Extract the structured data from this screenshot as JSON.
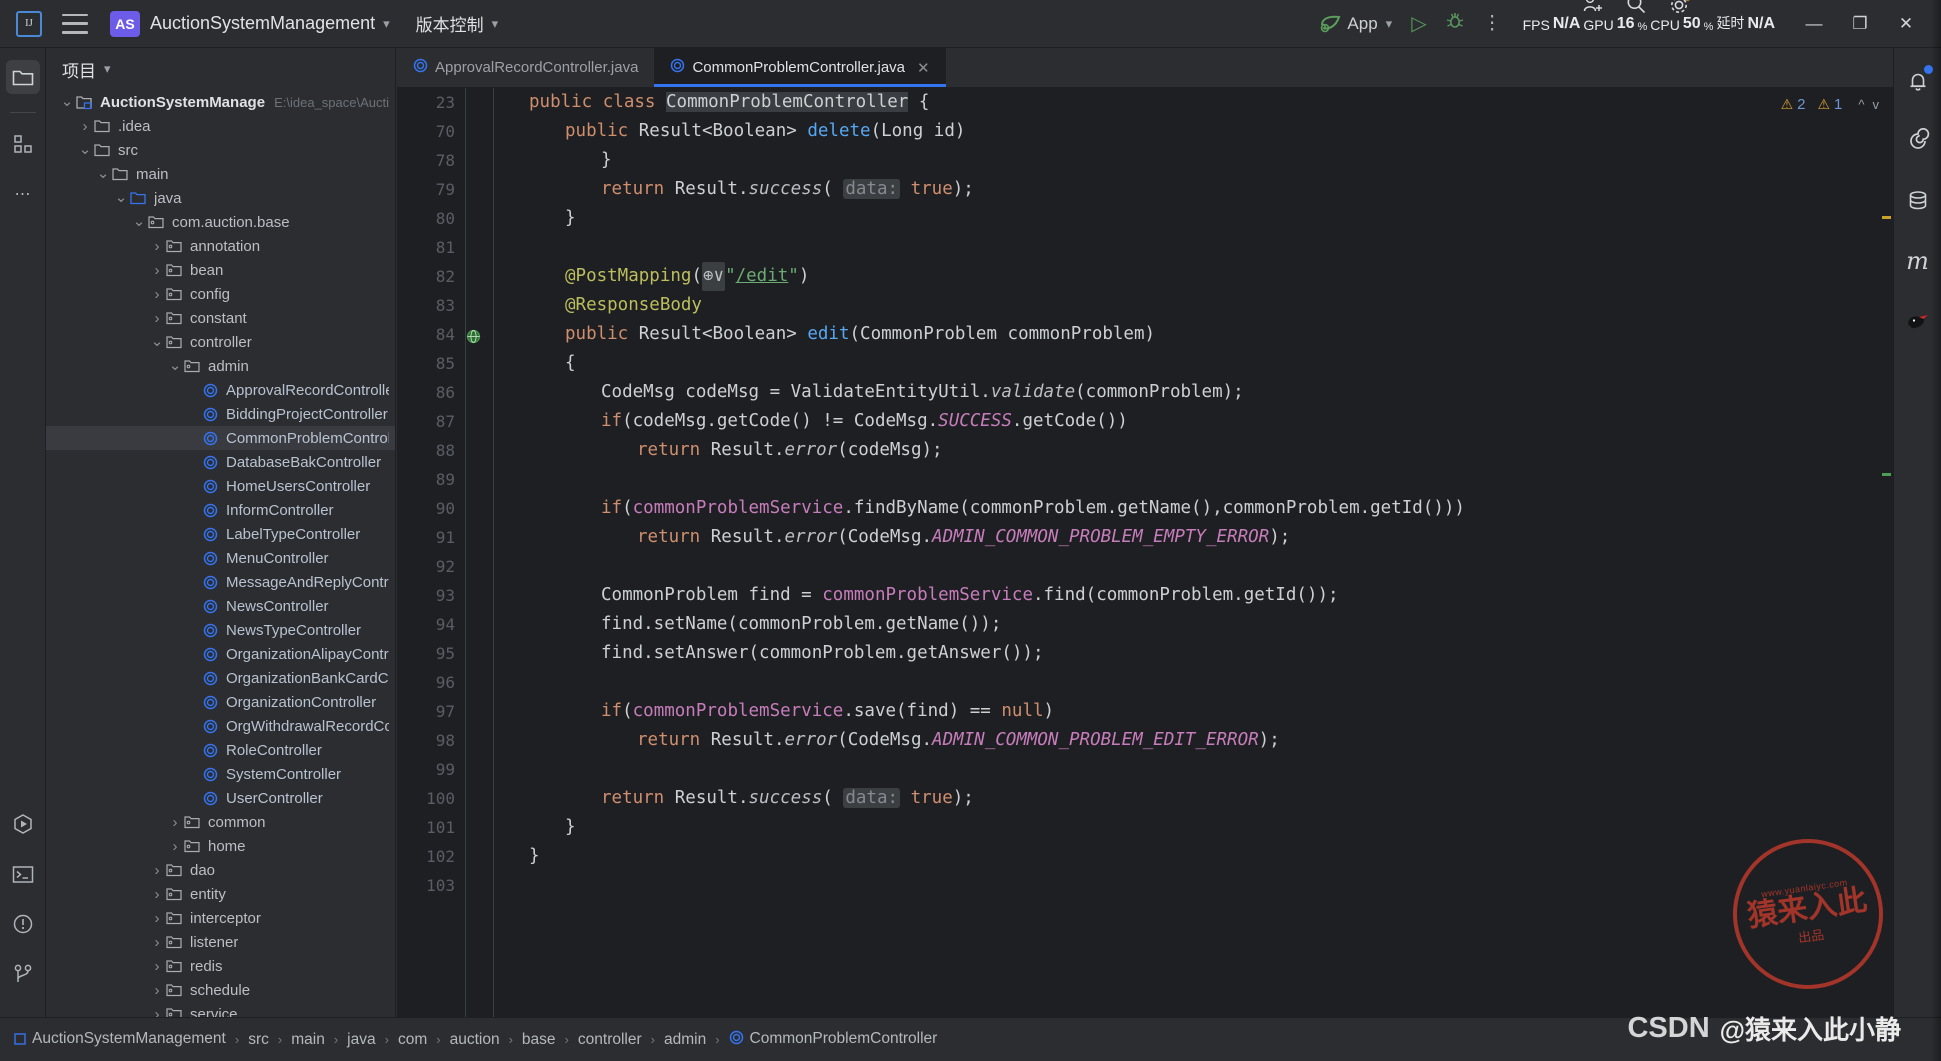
{
  "titlebar": {
    "logo": "ij-logo",
    "menu_icon": "hamburger-icon",
    "project_badge": "AS",
    "project_name": "AuctionSystemManagement",
    "vcs_label": "版本控制",
    "run_config": "App",
    "run_icon": "run-icon",
    "debug_icon": "debug-icon",
    "more_icon": "more-options-icon",
    "perf": {
      "fps_label": "FPS",
      "fps_value": "N/A",
      "gpu_label": "GPU",
      "gpu_value": "16",
      "gpu_unit": "%",
      "cpu_label": "CPU",
      "cpu_value": "50",
      "cpu_unit": "%",
      "lat_label": "延时",
      "lat_value": "N/A"
    },
    "window": {
      "minimize": "—",
      "maximize": "❐",
      "close": "✕"
    }
  },
  "left_strip": {
    "items": [
      {
        "name": "project-tool-icon",
        "glyph": "folder",
        "active": true
      },
      {
        "name": "structure-tool-icon",
        "glyph": "blocks",
        "active": false
      },
      {
        "name": "more-tool-windows-icon",
        "glyph": "dots",
        "active": false
      }
    ],
    "bottom": [
      {
        "name": "run-tool-icon",
        "glyph": "run-hex"
      },
      {
        "name": "terminal-tool-icon",
        "glyph": "terminal"
      },
      {
        "name": "problems-tool-icon",
        "glyph": "warning-circle"
      },
      {
        "name": "version-control-tool-icon",
        "glyph": "branch"
      }
    ]
  },
  "project_panel": {
    "title": "项目",
    "tree": [
      {
        "depth": 0,
        "arrow": "v",
        "icon": "module",
        "label": "AuctionSystemManagement",
        "bold": true,
        "path": "E:\\idea_space\\Aucti"
      },
      {
        "depth": 1,
        "arrow": ">",
        "icon": "folder",
        "label": ".idea"
      },
      {
        "depth": 1,
        "arrow": "v",
        "icon": "folder",
        "label": "src"
      },
      {
        "depth": 2,
        "arrow": "v",
        "icon": "folder",
        "label": "main"
      },
      {
        "depth": 3,
        "arrow": "v",
        "icon": "source-folder",
        "label": "java"
      },
      {
        "depth": 4,
        "arrow": "v",
        "icon": "package",
        "label": "com.auction.base"
      },
      {
        "depth": 5,
        "arrow": ">",
        "icon": "package",
        "label": "annotation"
      },
      {
        "depth": 5,
        "arrow": ">",
        "icon": "package",
        "label": "bean"
      },
      {
        "depth": 5,
        "arrow": ">",
        "icon": "package",
        "label": "config"
      },
      {
        "depth": 5,
        "arrow": ">",
        "icon": "package",
        "label": "constant"
      },
      {
        "depth": 5,
        "arrow": "v",
        "icon": "package",
        "label": "controller"
      },
      {
        "depth": 6,
        "arrow": "v",
        "icon": "package",
        "label": "admin"
      },
      {
        "depth": 7,
        "arrow": "",
        "icon": "class",
        "label": "ApprovalRecordController"
      },
      {
        "depth": 7,
        "arrow": "",
        "icon": "class",
        "label": "BiddingProjectController"
      },
      {
        "depth": 7,
        "arrow": "",
        "icon": "class",
        "label": "CommonProblemController",
        "selected": true
      },
      {
        "depth": 7,
        "arrow": "",
        "icon": "class",
        "label": "DatabaseBakController"
      },
      {
        "depth": 7,
        "arrow": "",
        "icon": "class",
        "label": "HomeUsersController"
      },
      {
        "depth": 7,
        "arrow": "",
        "icon": "class",
        "label": "InformController"
      },
      {
        "depth": 7,
        "arrow": "",
        "icon": "class",
        "label": "LabelTypeController"
      },
      {
        "depth": 7,
        "arrow": "",
        "icon": "class",
        "label": "MenuController"
      },
      {
        "depth": 7,
        "arrow": "",
        "icon": "class",
        "label": "MessageAndReplyController"
      },
      {
        "depth": 7,
        "arrow": "",
        "icon": "class",
        "label": "NewsController"
      },
      {
        "depth": 7,
        "arrow": "",
        "icon": "class",
        "label": "NewsTypeController"
      },
      {
        "depth": 7,
        "arrow": "",
        "icon": "class",
        "label": "OrganizationAlipayController"
      },
      {
        "depth": 7,
        "arrow": "",
        "icon": "class",
        "label": "OrganizationBankCardController"
      },
      {
        "depth": 7,
        "arrow": "",
        "icon": "class",
        "label": "OrganizationController"
      },
      {
        "depth": 7,
        "arrow": "",
        "icon": "class",
        "label": "OrgWithdrawalRecordController"
      },
      {
        "depth": 7,
        "arrow": "",
        "icon": "class",
        "label": "RoleController"
      },
      {
        "depth": 7,
        "arrow": "",
        "icon": "class",
        "label": "SystemController"
      },
      {
        "depth": 7,
        "arrow": "",
        "icon": "class",
        "label": "UserController"
      },
      {
        "depth": 6,
        "arrow": ">",
        "icon": "package",
        "label": "common"
      },
      {
        "depth": 6,
        "arrow": ">",
        "icon": "package",
        "label": "home"
      },
      {
        "depth": 5,
        "arrow": ">",
        "icon": "package",
        "label": "dao"
      },
      {
        "depth": 5,
        "arrow": ">",
        "icon": "package",
        "label": "entity"
      },
      {
        "depth": 5,
        "arrow": ">",
        "icon": "package",
        "label": "interceptor"
      },
      {
        "depth": 5,
        "arrow": ">",
        "icon": "package",
        "label": "listener"
      },
      {
        "depth": 5,
        "arrow": ">",
        "icon": "package",
        "label": "redis"
      },
      {
        "depth": 5,
        "arrow": ">",
        "icon": "package",
        "label": "schedule"
      },
      {
        "depth": 5,
        "arrow": ">",
        "icon": "package",
        "label": "service"
      }
    ]
  },
  "editor": {
    "tabs": [
      {
        "name": "tab-approval-record-controller",
        "label": "ApprovalRecordController.java",
        "active": false,
        "closable": false
      },
      {
        "name": "tab-common-problem-controller",
        "label": "CommonProblemController.java",
        "active": true,
        "closable": true,
        "close_glyph": "✕"
      }
    ],
    "inspections": {
      "warning_count_1": "2",
      "warning_count_2": "1",
      "up_glyph": "^",
      "down_glyph": "v"
    },
    "lines": [
      {
        "n": "23",
        "fold": false,
        "html": "<span class='kw'>public</span> <span class='kw'>class</span> <span class='hl'>CommonProblemController</span> {",
        "indent": 1
      },
      {
        "n": "70",
        "fold": false,
        "html": "<span class='kw'>public</span> Result&lt;Boolean&gt; <span class='fn'>delete</span>(Long id)",
        "indent": 2
      },
      {
        "n": "78",
        "fold": true,
        "html": "}",
        "indent": 3
      },
      {
        "n": "79",
        "fold": true,
        "html": "<span class='kw'>return</span> Result.<span class='stm'>success</span>( <span class='hint'>data:</span> <span class='kw'>true</span>);",
        "indent": 3
      },
      {
        "n": "80",
        "fold": true,
        "html": "}",
        "indent": 2
      },
      {
        "n": "81",
        "fold": false,
        "html": "",
        "indent": 2
      },
      {
        "n": "82",
        "fold": false,
        "html": "<span class='ann'>@PostMapping</span>(<span class='globe'>⊕∨</span><span class='str'>\"</span><span class='lnk'>/edit</span><span class='str'>\"</span>)",
        "indent": 2
      },
      {
        "n": "83",
        "fold": false,
        "html": "<span class='ann'>@ResponseBody</span>",
        "indent": 2
      },
      {
        "n": "84",
        "fold": false,
        "gutter_mark": "web-mapping-icon",
        "html": "<span class='kw'>public</span> Result&lt;Boolean&gt; <span class='fn'>edit</span>(CommonProblem commonProblem)",
        "indent": 2
      },
      {
        "n": "85",
        "fold": false,
        "html": "{",
        "indent": 2
      },
      {
        "n": "86",
        "fold": true,
        "html": "CodeMsg codeMsg = ValidateEntityUtil.<span class='stm'>validate</span>(commonProblem);",
        "indent": 3
      },
      {
        "n": "87",
        "fold": true,
        "html": "<span class='kw'>if</span>(codeMsg.getCode() != CodeMsg.<span class='sfld'>SUCCESS</span>.getCode())",
        "indent": 3
      },
      {
        "n": "88",
        "fold": true,
        "html": "<span class='kw'>return</span> Result.<span class='stm'>error</span>(codeMsg);",
        "indent": 4
      },
      {
        "n": "89",
        "fold": true,
        "html": "",
        "indent": 3
      },
      {
        "n": "90",
        "fold": true,
        "html": "<span class='kw'>if</span>(<span class='fld'>commonProblemService</span>.findByName(commonProblem.getName(),commonProblem.getId()))",
        "indent": 3
      },
      {
        "n": "91",
        "fold": true,
        "html": "<span class='kw'>return</span> Result.<span class='stm'>error</span>(CodeMsg.<span class='sfld'>ADMIN_COMMON_PROBLEM_EMPTY_ERROR</span>);",
        "indent": 4
      },
      {
        "n": "92",
        "fold": true,
        "html": "",
        "indent": 3
      },
      {
        "n": "93",
        "fold": true,
        "html": "CommonProblem find = <span class='fld'>commonProblemService</span>.find(commonProblem.getId());",
        "indent": 3
      },
      {
        "n": "94",
        "fold": true,
        "html": "find.setName(commonProblem.getName());",
        "indent": 3
      },
      {
        "n": "95",
        "fold": true,
        "html": "find.setAnswer(commonProblem.getAnswer());",
        "indent": 3
      },
      {
        "n": "96",
        "fold": true,
        "html": "",
        "indent": 3
      },
      {
        "n": "97",
        "fold": true,
        "html": "<span class='kw'>if</span>(<span class='fld'>commonProblemService</span>.save(find) == <span class='kw'>null</span>)",
        "indent": 3
      },
      {
        "n": "98",
        "fold": true,
        "html": "<span class='kw'>return</span> Result.<span class='stm'>error</span>(CodeMsg.<span class='sfld'>ADMIN_COMMON_PROBLEM_EDIT_ERROR</span>);",
        "indent": 4
      },
      {
        "n": "99",
        "fold": true,
        "html": "",
        "indent": 3
      },
      {
        "n": "100",
        "fold": true,
        "html": "<span class='kw'>return</span> Result.<span class='stm'>success</span>( <span class='hint'>data:</span> <span class='kw'>true</span>);",
        "indent": 3
      },
      {
        "n": "101",
        "fold": true,
        "html": "}",
        "indent": 2
      },
      {
        "n": "102",
        "fold": false,
        "html": "}",
        "indent": 1
      },
      {
        "n": "103",
        "fold": false,
        "html": "",
        "indent": 1
      }
    ]
  },
  "right_strip": {
    "items": [
      {
        "name": "notifications-icon",
        "glyph": "bell",
        "badge": true
      },
      {
        "name": "ai-assistant-icon",
        "glyph": "spiral"
      },
      {
        "name": "database-icon",
        "glyph": "database"
      },
      {
        "name": "maven-icon",
        "glyph": "m"
      },
      {
        "name": "bird-plugin-icon",
        "glyph": "bird"
      }
    ]
  },
  "status_bar": {
    "breadcrumb": [
      {
        "name": "crumb-project",
        "label": "AuctionSystemManagement",
        "icon": "module-icon"
      },
      {
        "name": "crumb-src",
        "label": "src"
      },
      {
        "name": "crumb-main",
        "label": "main"
      },
      {
        "name": "crumb-java",
        "label": "java"
      },
      {
        "name": "crumb-com",
        "label": "com"
      },
      {
        "name": "crumb-auction",
        "label": "auction"
      },
      {
        "name": "crumb-base",
        "label": "base"
      },
      {
        "name": "crumb-controller",
        "label": "controller"
      },
      {
        "name": "crumb-admin",
        "label": "admin"
      },
      {
        "name": "crumb-class",
        "label": "CommonProblemController",
        "icon": "class-icon"
      }
    ],
    "separator": "›"
  },
  "watermarks": {
    "stamp_top": "www.yuanlaiyc.com",
    "stamp_main": "猿来入此",
    "stamp_bottom": "出品",
    "csdn_brand": "CSDN",
    "csdn_handle": "@猿来入此小静"
  },
  "colors": {
    "accent": "#3574f0",
    "bg_chrome": "#2b2d30",
    "bg_editor": "#1e1f22",
    "selection": "#393b40",
    "warning": "#d8a033",
    "green": "#6aab73",
    "keyword": "#cf8e6d",
    "field": "#c77dbb",
    "method": "#56a8f5",
    "annotation": "#bcbe5e"
  }
}
